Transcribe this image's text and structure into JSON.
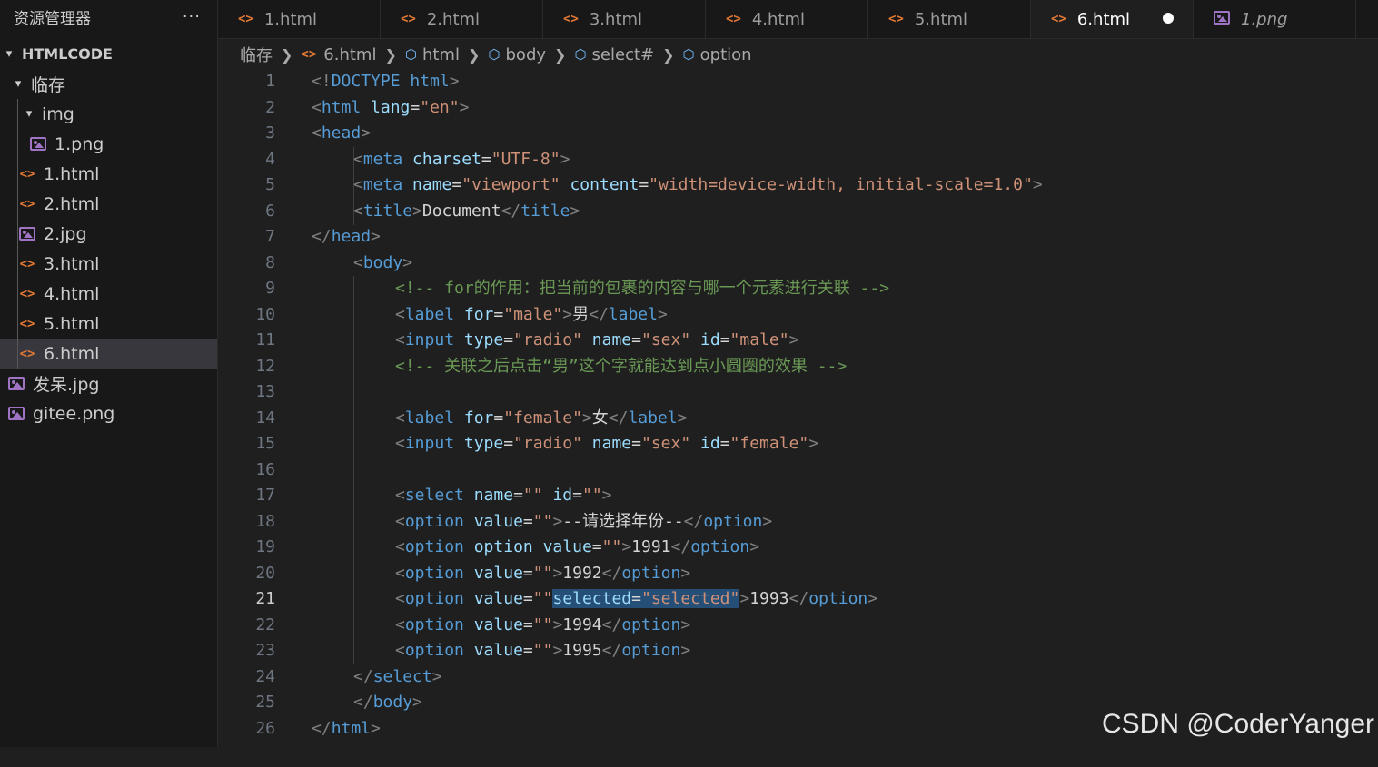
{
  "explorer": {
    "title": "资源管理器",
    "more": "···",
    "root": "HTMLCODE",
    "tree": [
      {
        "label": "临存",
        "kind": "folder"
      },
      {
        "label": "img",
        "kind": "folder"
      },
      {
        "label": "1.png",
        "kind": "image"
      },
      {
        "label": "1.html",
        "kind": "html"
      },
      {
        "label": "2.html",
        "kind": "html"
      },
      {
        "label": "2.jpg",
        "kind": "image"
      },
      {
        "label": "3.html",
        "kind": "html"
      },
      {
        "label": "4.html",
        "kind": "html"
      },
      {
        "label": "5.html",
        "kind": "html"
      },
      {
        "label": "6.html",
        "kind": "html",
        "active": true
      },
      {
        "label": "发呆.jpg",
        "kind": "image"
      },
      {
        "label": "gitee.png",
        "kind": "image"
      }
    ]
  },
  "tabs": [
    {
      "label": "1.html",
      "icon": "html-icon"
    },
    {
      "label": "2.html",
      "icon": "html-icon"
    },
    {
      "label": "3.html",
      "icon": "html-icon"
    },
    {
      "label": "4.html",
      "icon": "html-icon"
    },
    {
      "label": "5.html",
      "icon": "html-icon"
    },
    {
      "label": "6.html",
      "icon": "html-icon",
      "active": true,
      "dirty": true
    },
    {
      "label": "1.png",
      "icon": "image-icon",
      "preview": true
    }
  ],
  "breadcrumb": [
    "临存",
    "6.html",
    "html",
    "body",
    "select#",
    "option"
  ],
  "editor": {
    "current_line": 21,
    "lines": [
      {
        "n": "1"
      },
      {
        "n": "2"
      },
      {
        "n": "3"
      },
      {
        "n": "4"
      },
      {
        "n": "5"
      },
      {
        "n": "6"
      },
      {
        "n": "7"
      },
      {
        "n": "8"
      },
      {
        "n": "9"
      },
      {
        "n": "10"
      },
      {
        "n": "11"
      },
      {
        "n": "12"
      },
      {
        "n": "13"
      },
      {
        "n": "14"
      },
      {
        "n": "15"
      },
      {
        "n": "16"
      },
      {
        "n": "17"
      },
      {
        "n": "18"
      },
      {
        "n": "19"
      },
      {
        "n": "20"
      },
      {
        "n": "21"
      },
      {
        "n": "22"
      },
      {
        "n": "23"
      },
      {
        "n": "24"
      },
      {
        "n": "25"
      },
      {
        "n": "26"
      }
    ],
    "tokens": {
      "l1": [
        "<!",
        "DOCTYPE",
        "html",
        ">"
      ],
      "l2": [
        "<",
        "html",
        "lang",
        "=",
        "\"en\"",
        ">"
      ],
      "l3": [
        "<",
        "head",
        ">"
      ],
      "l4": [
        "<",
        "meta",
        "charset",
        "=",
        "\"UTF-8\"",
        ">"
      ],
      "l5": [
        "<",
        "meta",
        "name",
        "=",
        "\"viewport\"",
        "content",
        "=",
        "\"width=device-width, initial-scale=1.0\"",
        ">"
      ],
      "l6": [
        "<",
        "title",
        ">",
        "Document",
        "</",
        "title",
        ">"
      ],
      "l7": [
        "</",
        "head",
        ">"
      ],
      "l8": [
        "<",
        "body",
        ">"
      ],
      "l9": [
        "<!-- for的作用：把当前的包裹的内容与哪一个元素进行关联 -->"
      ],
      "l10": [
        "<",
        "label",
        "for",
        "=",
        "\"male\"",
        ">",
        "男",
        "</",
        "label",
        ">"
      ],
      "l11": [
        "<",
        "input",
        "type",
        "=",
        "\"radio\"",
        "name",
        "=",
        "\"sex\"",
        "id",
        "=",
        "\"male\"",
        ">"
      ],
      "l12": [
        "<!-- 关联之后点击“男”这个字就能达到点小圆圈的效果 -->"
      ],
      "l14": [
        "<",
        "label",
        "for",
        "=",
        "\"female\"",
        ">",
        "女",
        "</",
        "label",
        ">"
      ],
      "l15": [
        "<",
        "input",
        "type",
        "=",
        "\"radio\"",
        "name",
        "=",
        "\"sex\"",
        "id",
        "=",
        "\"female\"",
        ">"
      ],
      "l17": [
        "<",
        "select",
        "name",
        "=",
        "\"\"",
        "id",
        "=",
        "\"\"",
        ">"
      ],
      "l18": [
        "<",
        "option",
        "value",
        "=",
        "\"\"",
        ">",
        "--请选择年份--",
        "</",
        "option",
        ">"
      ],
      "l19": [
        "<",
        "option",
        "option",
        "value",
        "=",
        "\"\"",
        ">",
        "1991",
        "</",
        "option",
        ">"
      ],
      "l20": [
        "<",
        "option",
        "value",
        "=",
        "\"\"",
        ">",
        "1992",
        "</",
        "option",
        ">"
      ],
      "l21": [
        "<",
        "option",
        "value",
        "=",
        "\"\"",
        "selected",
        "=",
        "\"selected\"",
        ">",
        "1993",
        "</",
        "option",
        ">"
      ],
      "l22": [
        "<",
        "option",
        "value",
        "=",
        "\"\"",
        ">",
        "1994",
        "</",
        "option",
        ">"
      ],
      "l23": [
        "<",
        "option",
        "value",
        "=",
        "\"\"",
        ">",
        "1995",
        "</",
        "option",
        ">"
      ],
      "l24": [
        "</",
        "select",
        ">"
      ],
      "l25": [
        "</",
        "body",
        ">"
      ],
      "l26": [
        "</",
        "html",
        ">"
      ]
    }
  },
  "watermark": "CSDN @CoderYanger",
  "colors": {
    "tag": "#569cd6",
    "attribute": "#9cdcfe",
    "string": "#ce9178",
    "comment": "#6a9955",
    "text": "#d4d4d4",
    "bracket": "#808080",
    "selection": "#264f78",
    "html_icon": "#e37933",
    "image_icon": "#a074c4"
  }
}
